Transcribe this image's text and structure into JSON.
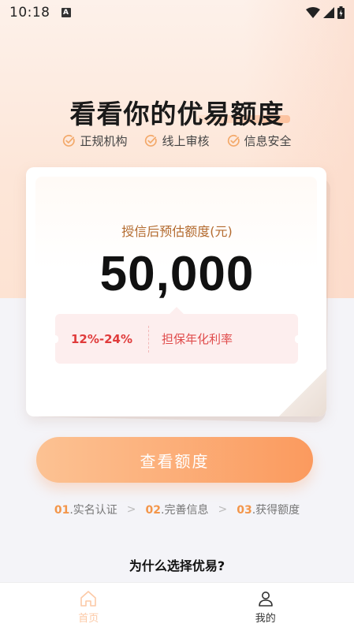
{
  "status_bar": {
    "time": "10:18",
    "notification_letter": "A"
  },
  "hero": {
    "title": "看看你的优易额度",
    "features": [
      "正规机构",
      "线上审核",
      "信息安全"
    ]
  },
  "credit_card": {
    "label": "授信后预估额度(元)",
    "amount": "50,000",
    "rate_value": "12%-24%",
    "rate_label": "担保年化利率"
  },
  "cta": {
    "label": "查看额度"
  },
  "steps": [
    {
      "num": "01",
      "text": ".实名认证"
    },
    {
      "num": "02",
      "text": ".完善信息"
    },
    {
      "num": "03",
      "text": ".获得额度"
    }
  ],
  "step_separator": ">",
  "why_title": "为什么选择优易?",
  "tabbar": {
    "home": {
      "label": "首页",
      "icon": "home-icon"
    },
    "me": {
      "label": "我的",
      "icon": "user-icon"
    }
  },
  "colors": {
    "accent": "#fb9a5e",
    "rate_red": "#e03b3b",
    "label_brown": "#b36a2e",
    "step_orange": "#f3964a"
  }
}
